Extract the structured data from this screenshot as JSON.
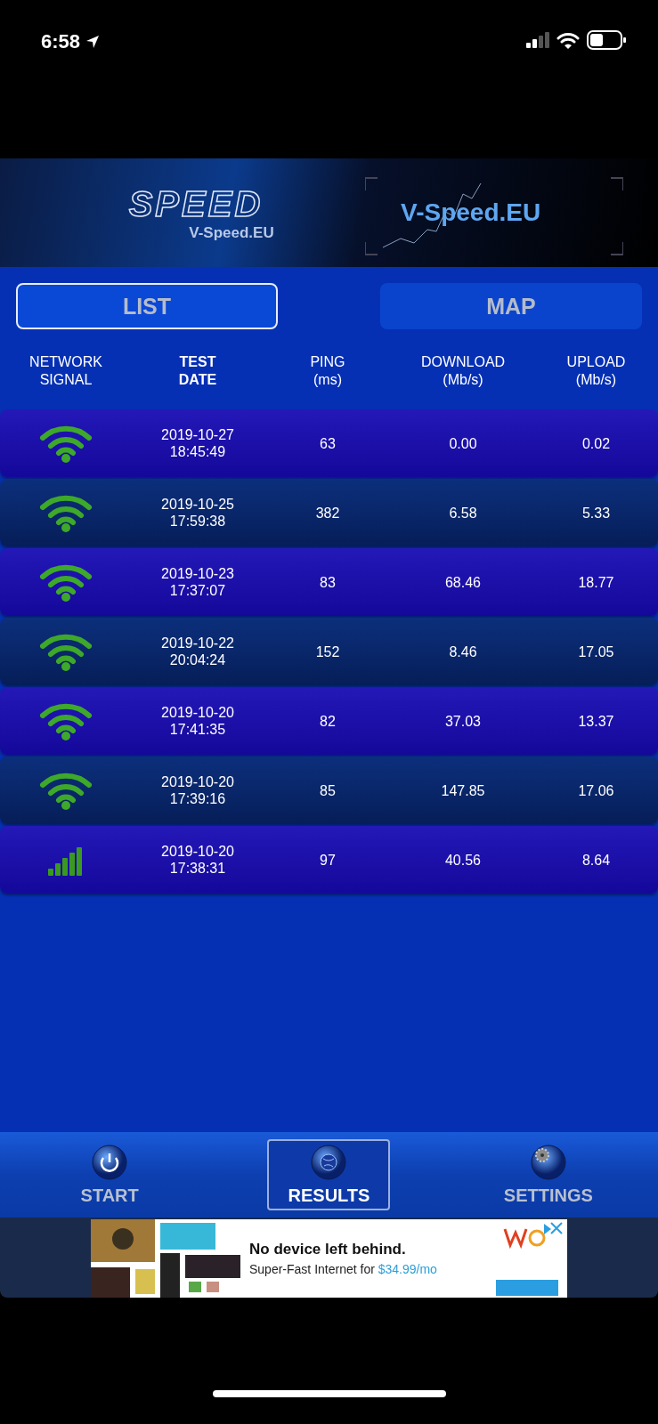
{
  "status_bar": {
    "time": "6:58"
  },
  "banner": {
    "logo": "SPEED",
    "logo_caption": "V-Speed.EU",
    "title": "V-Speed.EU"
  },
  "tabs": [
    {
      "label": "LIST",
      "selected": true
    },
    {
      "label": "MAP",
      "selected": false
    }
  ],
  "table": {
    "columns": [
      {
        "label": "NETWORK\nSIGNAL",
        "bold": false
      },
      {
        "label": "TEST\nDATE",
        "bold": true
      },
      {
        "label": "PING\n(ms)",
        "bold": false
      },
      {
        "label": "DOWNLOAD\n(Mb/s)",
        "bold": false
      },
      {
        "label": "UPLOAD\n(Mb/s)",
        "bold": false
      }
    ],
    "rows": [
      {
        "kind": "wifi",
        "date": "2019-10-27\n18:45:49",
        "ping": "63",
        "download": "0.00",
        "upload": "0.02"
      },
      {
        "kind": "wifi",
        "date": "2019-10-25\n17:59:38",
        "ping": "382",
        "download": "6.58",
        "upload": "5.33"
      },
      {
        "kind": "wifi",
        "date": "2019-10-23\n17:37:07",
        "ping": "83",
        "download": "68.46",
        "upload": "18.77"
      },
      {
        "kind": "wifi",
        "date": "2019-10-22\n20:04:24",
        "ping": "152",
        "download": "8.46",
        "upload": "17.05"
      },
      {
        "kind": "wifi",
        "date": "2019-10-20\n17:41:35",
        "ping": "82",
        "download": "37.03",
        "upload": "13.37"
      },
      {
        "kind": "wifi",
        "date": "2019-10-20\n17:39:16",
        "ping": "85",
        "download": "147.85",
        "upload": "17.06"
      },
      {
        "kind": "cellular",
        "date": "2019-10-20\n17:38:31",
        "ping": "97",
        "download": "40.56",
        "upload": "8.64"
      }
    ]
  },
  "bottom_nav": [
    {
      "label": "START",
      "kind": "power",
      "selected": false
    },
    {
      "label": "RESULTS",
      "kind": "globe",
      "selected": true
    },
    {
      "label": "SETTINGS",
      "kind": "gears",
      "selected": false
    }
  ],
  "ad": {
    "headline": "No device left behind.",
    "text": "Super-Fast Internet for ",
    "price": "$34.99/mo"
  }
}
